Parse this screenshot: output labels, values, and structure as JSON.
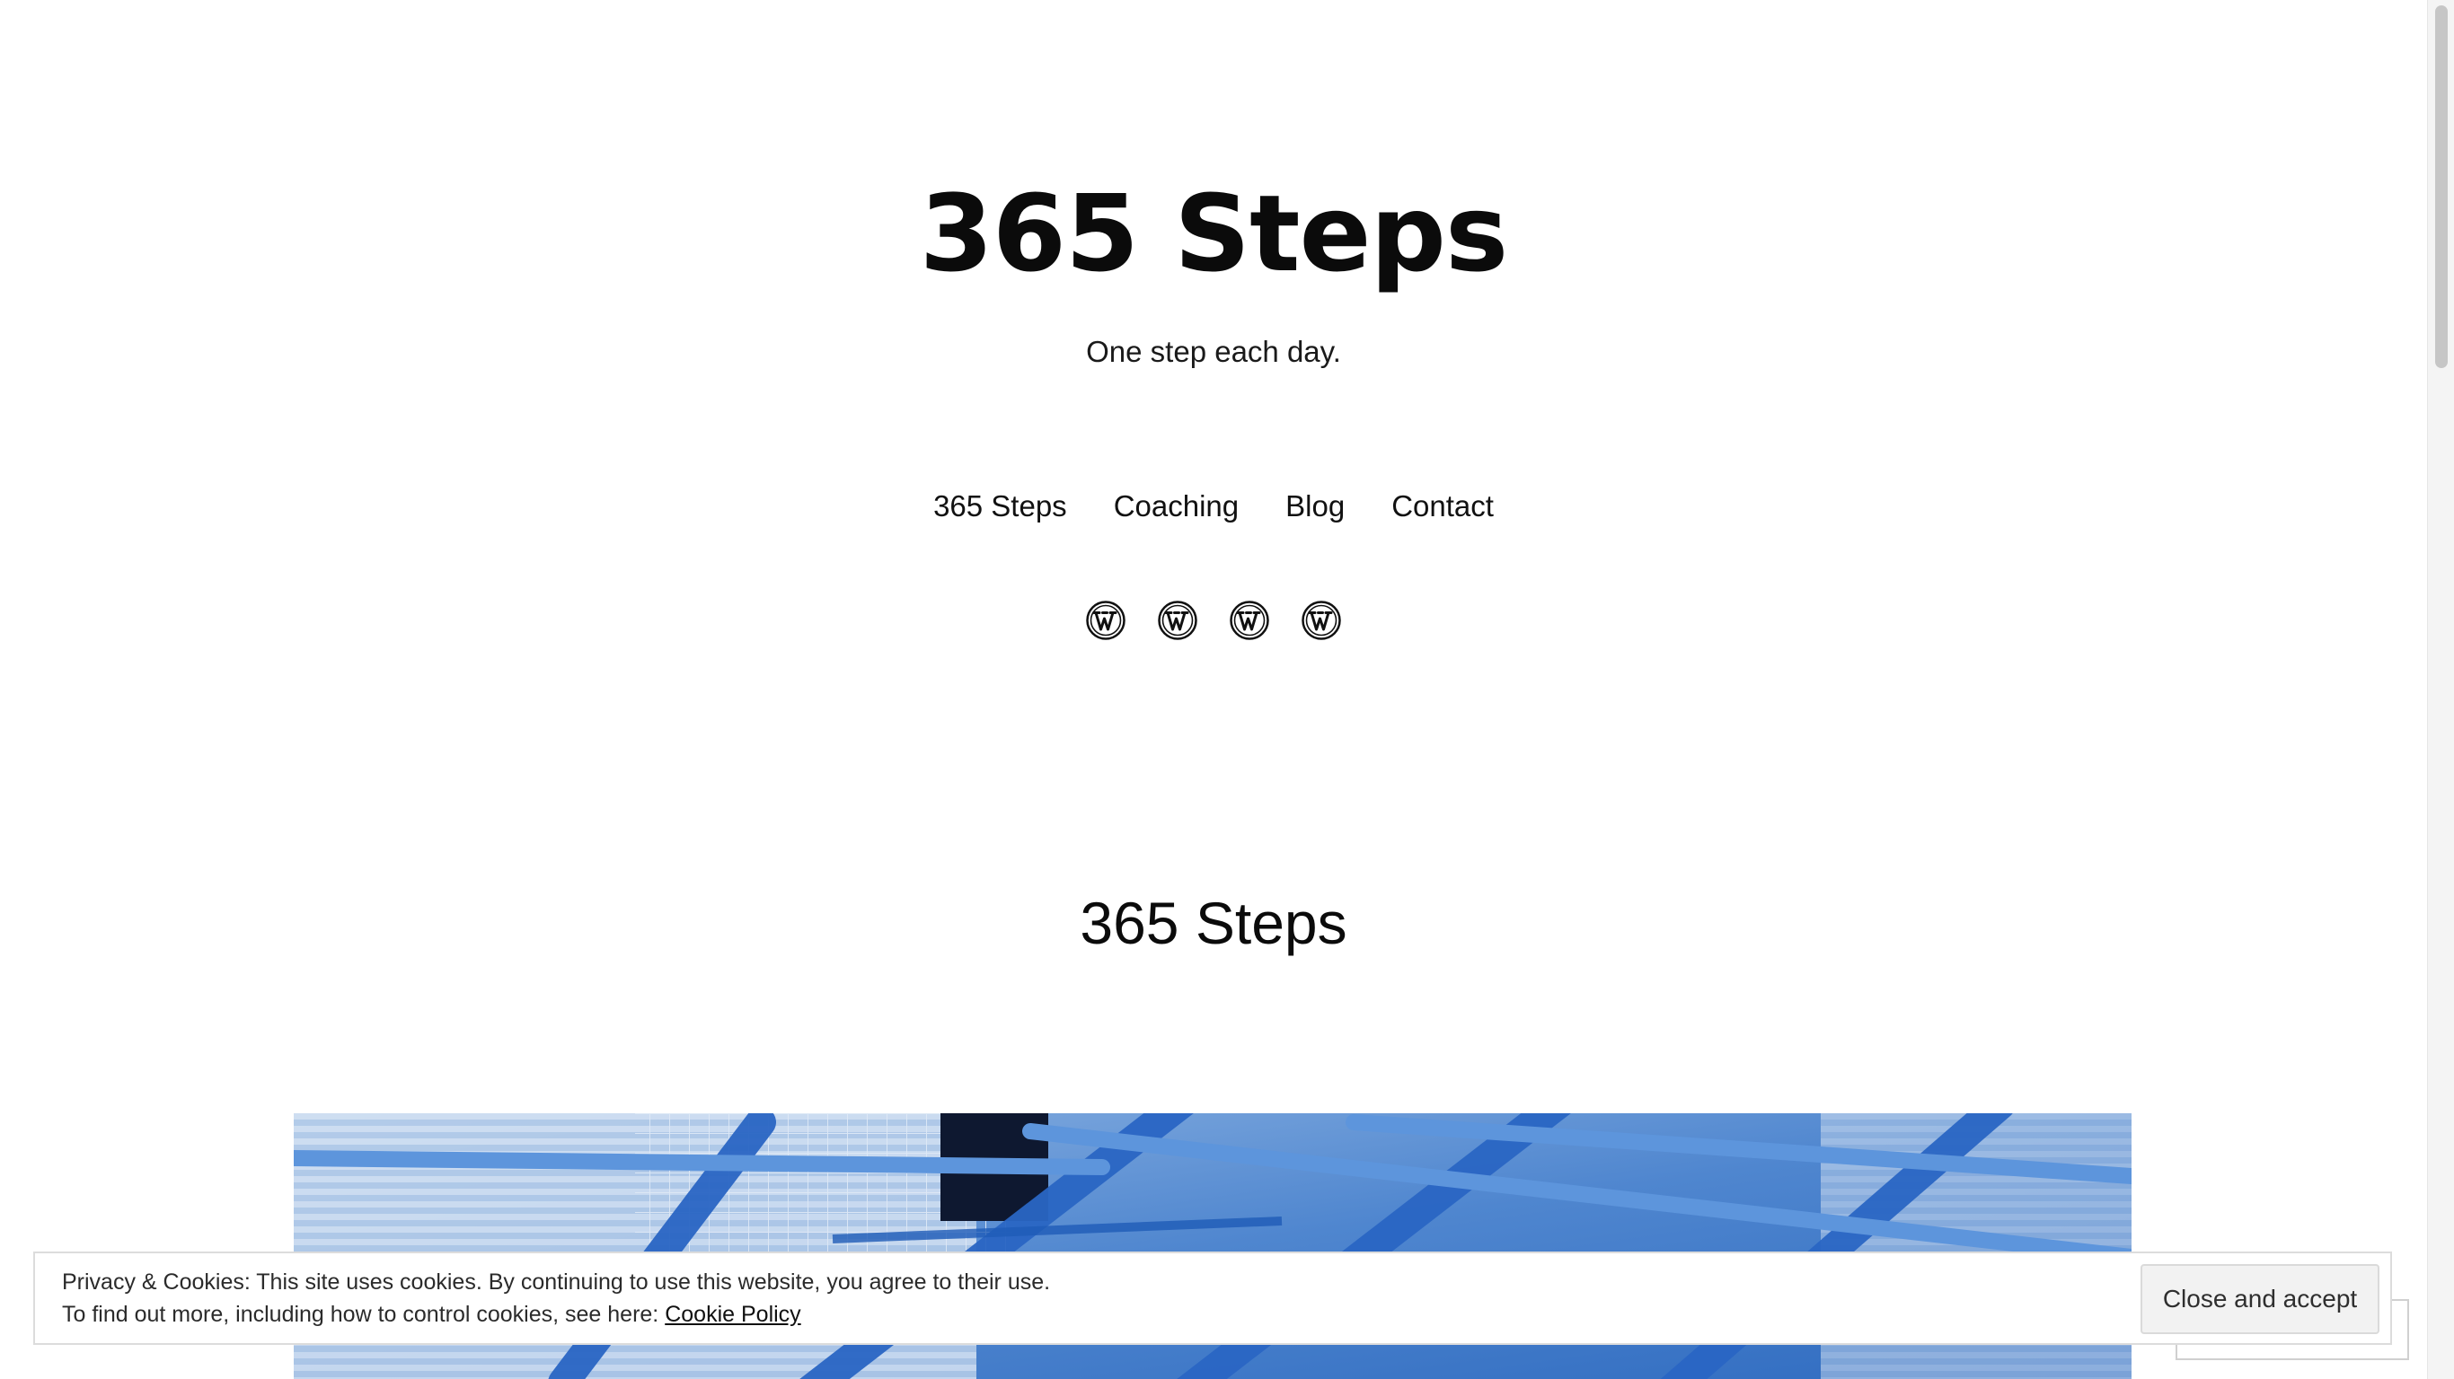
{
  "site": {
    "title": "365 Steps",
    "tagline": "One step each day."
  },
  "nav": {
    "items": [
      {
        "label": "365 Steps"
      },
      {
        "label": "Coaching"
      },
      {
        "label": "Blog"
      },
      {
        "label": "Contact"
      }
    ]
  },
  "social": {
    "icons": [
      "wordpress-icon",
      "wordpress-icon",
      "wordpress-icon",
      "wordpress-icon"
    ]
  },
  "page": {
    "heading": "365 Steps"
  },
  "cookie": {
    "line1": "Privacy & Cookies: This site uses cookies. By continuing to use this website, you agree to their use.",
    "line2_prefix": "To find out more, including how to control cookies, see here: ",
    "link_label": "Cookie Policy",
    "button_label": "Close and accept"
  },
  "colors": {
    "text": "#111111",
    "background": "#ffffff",
    "hero_blue": "#3f7fd0"
  }
}
